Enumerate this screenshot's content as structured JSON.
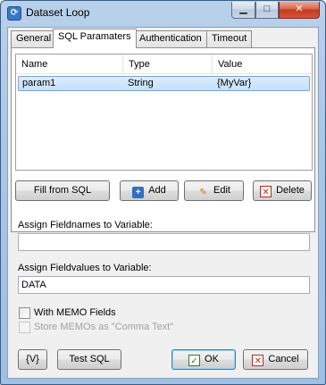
{
  "window": {
    "title": "Dataset Loop",
    "controls": {
      "minimize": "▁",
      "maximize": "□",
      "close": "✕"
    }
  },
  "tabs": [
    {
      "label": "General",
      "active": false
    },
    {
      "label": "SQL Paramaters",
      "active": true
    },
    {
      "label": "Authentication",
      "active": false
    },
    {
      "label": "Timeout",
      "active": false
    }
  ],
  "params_table": {
    "columns": [
      "Name",
      "Type",
      "Value"
    ],
    "rows": [
      {
        "name": "param1",
        "type": "String",
        "value": "{MyVar}",
        "selected": true
      }
    ]
  },
  "param_buttons": {
    "fill": "Fill from SQL",
    "add": "Add",
    "edit": "Edit",
    "delete": "Delete"
  },
  "fields": {
    "fieldnames_label": "Assign Fieldnames to Variable:",
    "fieldnames_value": "",
    "fieldvalues_label": "Assign Fieldvalues to Variable:",
    "fieldvalues_value": "DATA"
  },
  "options": {
    "memo_label": "With MEMO Fields",
    "memo_checked": false,
    "comma_label": "Store MEMOs as \"Comma Text\"",
    "comma_checked": false,
    "comma_enabled": false
  },
  "footer": {
    "var_button": "{V}",
    "test_button": "Test SQL",
    "ok_button": "OK",
    "cancel_button": "Cancel"
  },
  "icons": {
    "app": "dataset-loop-icon",
    "add": "plus-icon",
    "edit": "pencil-icon",
    "delete": "x-icon",
    "ok": "checkmark-icon",
    "cancel": "x-icon"
  },
  "colors": {
    "selection": "#c4e0fc",
    "title_bar": "#b9d1ea",
    "close_button": "#c4391f"
  }
}
